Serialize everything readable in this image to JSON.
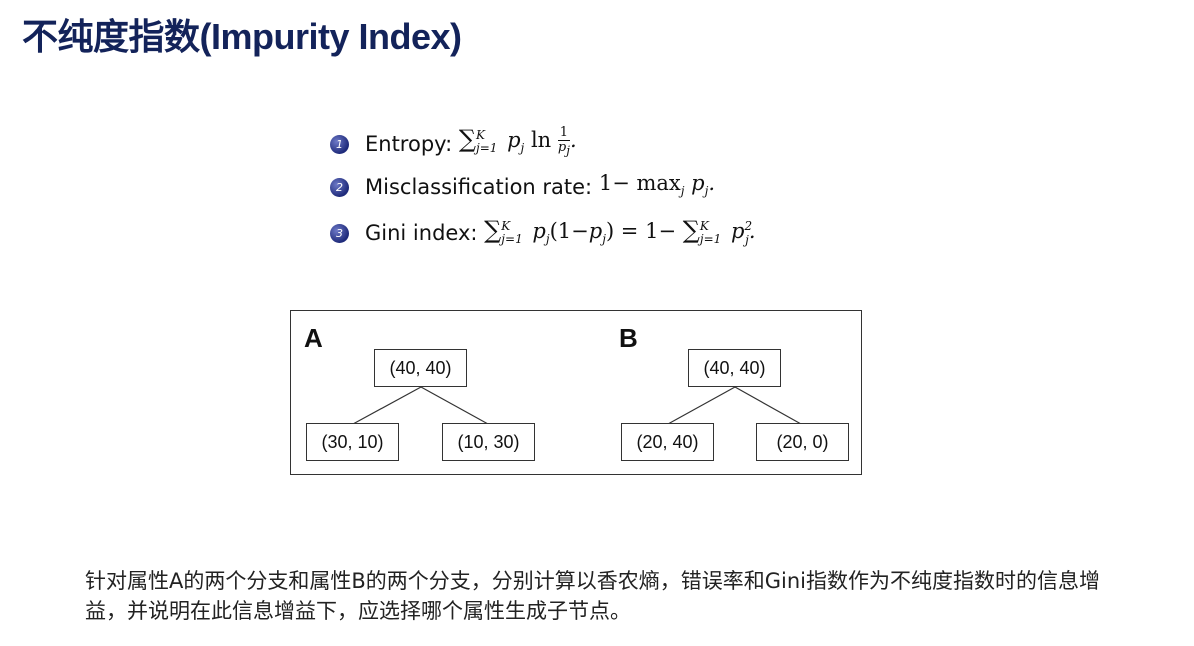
{
  "title": "不纯度指数(Impurity Index)",
  "formulas": [
    {
      "num": "1",
      "label": "Entropy:",
      "expr": "∑ p_j ln 1/p_j"
    },
    {
      "num": "2",
      "label": "Misclassification rate:",
      "expr": "1− max_j p_j"
    },
    {
      "num": "3",
      "label": "Gini index:",
      "expr": "∑ p_j(1−p_j) = 1−∑ p_j²"
    }
  ],
  "math": {
    "sum": "∑",
    "K": "K",
    "j1": "j=1",
    "p": "p",
    "j": "j",
    "ln": "ln",
    "one": "1",
    "dot": ".",
    "minus_max": "1− max",
    "gini_mid": "(1−",
    "gini_close": ") = 1−",
    "two": "2"
  },
  "diagram": {
    "A": {
      "label": "A",
      "root": "(40, 40)",
      "left": "(30, 10)",
      "right": "(10, 30)"
    },
    "B": {
      "label": "B",
      "root": "(40, 40)",
      "left": "(20, 40)",
      "right": "(20, 0)"
    }
  },
  "question": "针对属性A的两个分支和属性B的两个分支，分别计算以香农熵，错误率和Gini指数作为不纯度指数时的信息增益，并说明在此信息增益下，应选择哪个属性生成子节点。"
}
